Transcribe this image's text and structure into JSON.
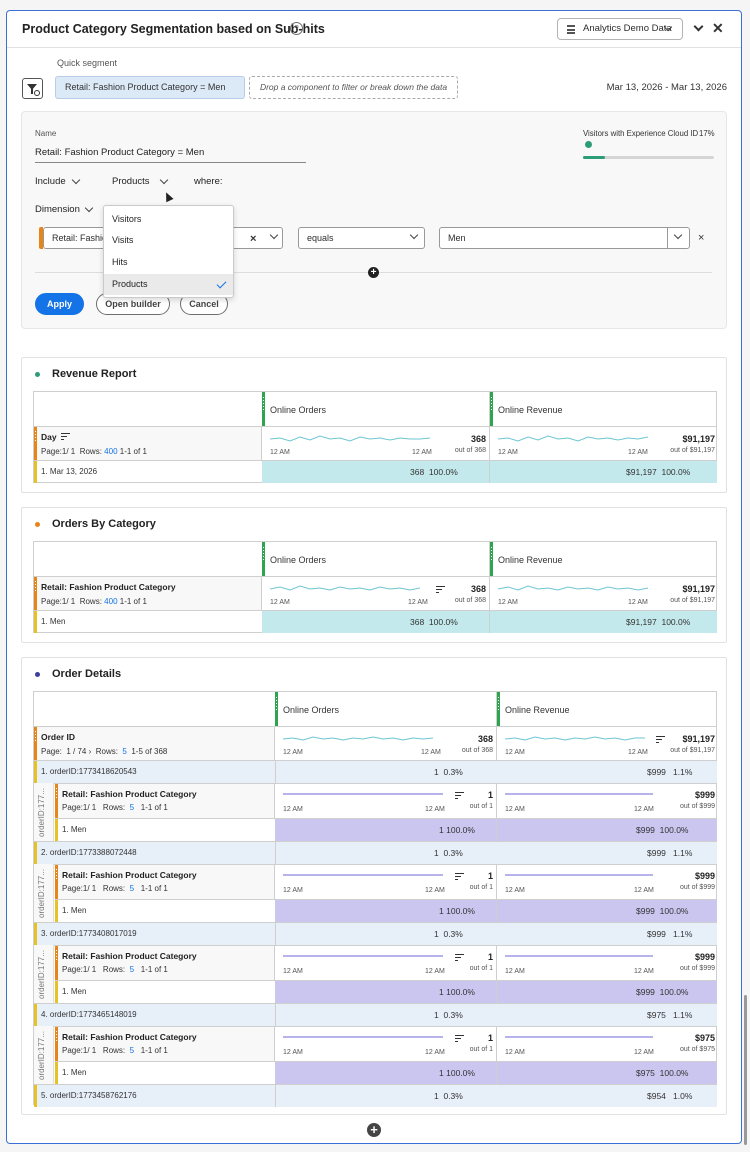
{
  "panel": {
    "title": "Product Category Segmentation based on Sub-hits",
    "help_icon": "?",
    "data_source": "Analytics Demo Data",
    "close": "✕"
  },
  "quick_segment": {
    "label": "Quick segment",
    "chip": "Retail: Fashion Product Category = Men",
    "drop_placeholder": "Drop a component to filter or break down the data",
    "date_range": "Mar 13, 2026 - Mar 13, 2026"
  },
  "builder": {
    "name_label": "Name",
    "name_value": "Retail: Fashion Product Category = Men",
    "vec_label": "Visitors with Experience Cloud ID",
    "vec_pct": "17%",
    "vec_fraction": 0.17,
    "include": "Include",
    "container": "Products",
    "where": "where:",
    "dimension": "Dimension",
    "condition_dimension": "Retail: Fashion",
    "operator": "equals",
    "value": "Men",
    "remove": "×",
    "apply": "Apply",
    "open_builder": "Open builder",
    "cancel": "Cancel",
    "container_options": [
      "Visitors",
      "Visits",
      "Hits",
      "Products"
    ],
    "selected_option": "Products"
  },
  "colors": {
    "accent": "#1473e6",
    "metric": "#2da44e",
    "dimension": "#e68619",
    "row_marker": "#e6c229",
    "highlight_teal": "#c4e9ec",
    "highlight_purple": "#cac6f0",
    "sparkline_teal": "#6cc6d3",
    "sparkline_purple": "#8a85e0"
  },
  "revenue_report": {
    "title": "Revenue Report",
    "col1": "Online Orders",
    "col2": "Online Revenue",
    "dim_name": "Day",
    "page": "Page:1/ 1",
    "rows_label": "Rows:",
    "rows_val": "400",
    "range": "1-1 of 1",
    "t1": "368",
    "t1_of": "out of 368",
    "t2": "$91,197",
    "t2_of": "out of $91,197",
    "axis_a": "12 AM",
    "axis_b": "12 AM",
    "row_label": "1.  Mar 13, 2026",
    "row_v1": "368",
    "row_p1": "100.0%",
    "row_v2": "$91,197",
    "row_p2": "100.0%"
  },
  "orders_by_category": {
    "title": "Orders By Category",
    "col1": "Online Orders",
    "col2": "Online Revenue",
    "dim_name": "Retail: Fashion Product Category",
    "page": "Page:1/ 1",
    "rows_label": "Rows:",
    "rows_val": "400",
    "range": "1-1 of 1",
    "t1": "368",
    "t1_of": "out of 368",
    "t2": "$91,197",
    "t2_of": "out of $91,197",
    "axis_a": "12 AM",
    "axis_b": "12 AM",
    "row_label": "1.  Men",
    "row_v1": "368",
    "row_p1": "100.0%",
    "row_v2": "$91,197",
    "row_p2": "100.0%"
  },
  "order_details": {
    "title": "Order Details",
    "col1": "Online Orders",
    "col2": "Online Revenue",
    "dim_name": "Order ID",
    "page_prefix": "Page:",
    "page_val": "1 / 74",
    "rows_label": "Rows:",
    "rows_val": "5",
    "range": "1-5 of 368",
    "t1": "368",
    "t1_of": "out of 368",
    "t2": "$91,197",
    "t2_of": "out of $91,197",
    "axis_a": "12 AM",
    "axis_b": "12 AM",
    "vert_label": "orderID:177...",
    "rows": [
      {
        "label": "1.  orderID:1773418620543",
        "v1": "1",
        "p1": "0.3%",
        "v2": "$999",
        "p2": "1.1%",
        "sub": {
          "dim": "Retail: Fashion Product Category",
          "page": "Page:1/ 1",
          "rows_label": "Rows:",
          "rows_val": "5",
          "range": "1-1 of 1",
          "t1": "1",
          "t1_of": "out of 1",
          "t2": "$999",
          "t2_of": "out of $999",
          "row": "1.  Men",
          "r1": "1",
          "rp1": "100.0%",
          "r2": "$999",
          "rp2": "100.0%"
        }
      },
      {
        "label": "2.  orderID:1773388072448",
        "v1": "1",
        "p1": "0.3%",
        "v2": "$999",
        "p2": "1.1%",
        "sub": {
          "dim": "Retail: Fashion Product Category",
          "page": "Page:1/ 1",
          "rows_label": "Rows:",
          "rows_val": "5",
          "range": "1-1 of 1",
          "t1": "1",
          "t1_of": "out of 1",
          "t2": "$999",
          "t2_of": "out of $999",
          "row": "1.  Men",
          "r1": "1",
          "rp1": "100.0%",
          "r2": "$999",
          "rp2": "100.0%"
        }
      },
      {
        "label": "3.  orderID:1773408017019",
        "v1": "1",
        "p1": "0.3%",
        "v2": "$999",
        "p2": "1.1%",
        "sub": {
          "dim": "Retail: Fashion Product Category",
          "page": "Page:1/ 1",
          "rows_label": "Rows:",
          "rows_val": "5",
          "range": "1-1 of 1",
          "t1": "1",
          "t1_of": "out of 1",
          "t2": "$999",
          "t2_of": "out of $999",
          "row": "1.  Men",
          "r1": "1",
          "rp1": "100.0%",
          "r2": "$999",
          "rp2": "100.0%"
        }
      },
      {
        "label": "4.  orderID:1773465148019",
        "v1": "1",
        "p1": "0.3%",
        "v2": "$975",
        "p2": "1.1%",
        "sub": {
          "dim": "Retail: Fashion Product Category",
          "page": "Page:1/ 1",
          "rows_label": "Rows:",
          "rows_val": "5",
          "range": "1-1 of 1",
          "t1": "1",
          "t1_of": "out of 1",
          "t2": "$975",
          "t2_of": "out of $975",
          "row": "1.  Men",
          "r1": "1",
          "rp1": "100.0%",
          "r2": "$975",
          "rp2": "100.0%"
        }
      },
      {
        "label": "5.  orderID:1773458762176",
        "v1": "1",
        "p1": "0.3%",
        "v2": "$954",
        "p2": "1.0%"
      }
    ]
  }
}
